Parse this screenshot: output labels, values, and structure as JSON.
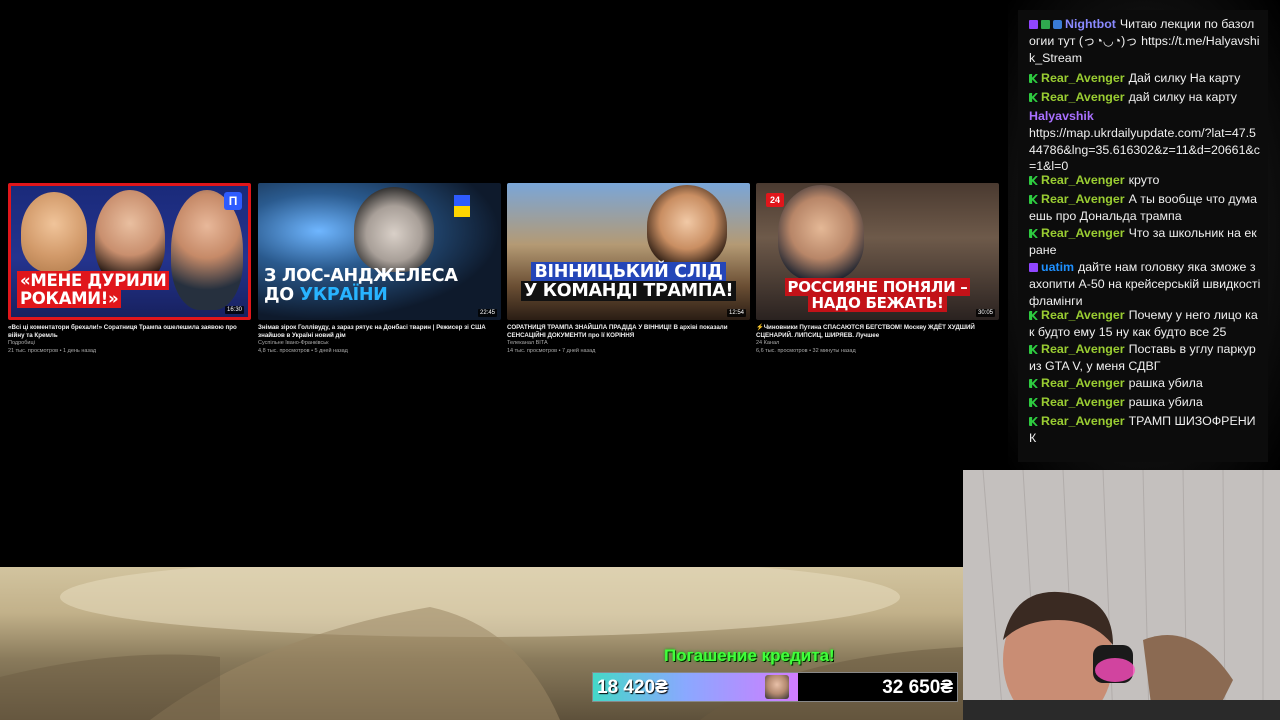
{
  "videos": [
    {
      "thumb_text_1": "«МЕНЕ ДУРИЛИ",
      "thumb_text_2": "РОКАМИ!»",
      "channel_logo": "П",
      "duration": "16:30",
      "title": "«Всі ці коментатори брехали!» Соратниця Трампа ошелешила заявою про війну та Кремль",
      "channel": "Подробиці",
      "meta": "21 тыс. просмотров • 1 день назад"
    },
    {
      "thumb_text_1": "З ЛОС-АНДЖЕЛЕСА",
      "thumb_text_2_prefix": "ДО ",
      "thumb_text_2_accent": "УКРАЇНИ",
      "duration": "22:45",
      "title": "Знімав зірок Голлівуду, а зараз рятує на Донбасі тварин | Режисер зі США знайшов в Україні новий дім",
      "channel": "Суспільне Івано-Франківськ",
      "meta": "4,8 тыс. просмотров • 5 дней назад"
    },
    {
      "thumb_text_1": "ВІННИЦЬКИЙ СЛІД",
      "thumb_text_2": "У КОМАНДІ ТРАМПА!",
      "duration": "12:54",
      "title": "СОРАТНИЦЯ ТРАМПА ЗНАЙШЛА ПРАДІДА У ВІННИЦІ! В архіві показали СЕНСАЦІЙНІ ДОКУМЕНТИ про її КОРІННЯ",
      "channel": "Телеканал ВІТА",
      "meta": "14 тыс. просмотров • 7 дней назад"
    },
    {
      "thumb_text_1": "РОССИЯНЕ ПОНЯЛИ –",
      "thumb_text_2": "НАДО БЕЖАТЬ!",
      "channel_logo": "24",
      "duration": "30:05",
      "title": "⚡Чиновники Путина СПАСАЮТСЯ БЕГСТВОМ! Москву ЖДЁТ ХУДШИЙ СЦЕНАРИЙ. ЛИПСИЦ, ШИРЯЕВ. Лучшее",
      "channel": "24 Канал",
      "meta": "6,6 тыс. просмотров • 32 минуты назад"
    }
  ],
  "chat": {
    "messages": [
      {
        "user": "Nightbot",
        "user_color": "#8a8aff",
        "badges": [
          "purple",
          "check",
          "bot"
        ],
        "text": "Читаю лекции по базологии тут (っ◔◡◔)っ https://t.me/Halyavshik_Stream"
      },
      {
        "user": "Rear_Avenger",
        "user_color": "#9acd32",
        "badges": [
          "green"
        ],
        "text": "Дай силку На карту"
      },
      {
        "user": "Rear_Avenger",
        "user_color": "#9acd32",
        "badges": [
          "green"
        ],
        "text": "дай силку на карту"
      },
      {
        "user": "Halyavshik",
        "user_color": "#a970ff",
        "badges": [],
        "text": "https://map.ukrdailyupdate.com/?lat=47.544786&lng=35.616302&z=11&d=20661&c=1&l=0"
      },
      {
        "user": "Rear_Avenger",
        "user_color": "#9acd32",
        "badges": [
          "green"
        ],
        "text": "круто"
      },
      {
        "user": "Rear_Avenger",
        "user_color": "#9acd32",
        "badges": [
          "green"
        ],
        "text": "А ты вообще что думаешь про Дональда трампа"
      },
      {
        "user": "Rear_Avenger",
        "user_color": "#9acd32",
        "badges": [
          "green"
        ],
        "text": "Что за школьник на екране"
      },
      {
        "user": "uatim",
        "user_color": "#1e90ff",
        "badges": [
          "purple"
        ],
        "text": "дайте нам головку яка зможе захопити А-50 на крейсерській швидкості фламінги"
      },
      {
        "user": "Rear_Avenger",
        "user_color": "#9acd32",
        "badges": [
          "green"
        ],
        "text": "Почему у него лицо как будто ему 15 ну как будто все 25"
      },
      {
        "user": "Rear_Avenger",
        "user_color": "#9acd32",
        "badges": [
          "green"
        ],
        "text": "Поставь в углу паркур из GTA V, у меня СДВГ"
      },
      {
        "user": "Rear_Avenger",
        "user_color": "#9acd32",
        "badges": [
          "green"
        ],
        "text": "рашка убила"
      },
      {
        "user": "Rear_Avenger",
        "user_color": "#9acd32",
        "badges": [
          "green"
        ],
        "text": "рашка убила"
      },
      {
        "user": "Rear_Avenger",
        "user_color": "#9acd32",
        "badges": [
          "green"
        ],
        "text": "ТРАМП ШИЗОФРЕНИК"
      }
    ]
  },
  "goal": {
    "label": "Погашение кредита!",
    "current": "18 420₴",
    "target": "32 650₴",
    "progress": 0.564
  },
  "colors": {
    "accent_goal": "#40ff3a",
    "thumb_red": "#e0161b",
    "thumb_blue": "#2e5bff"
  }
}
